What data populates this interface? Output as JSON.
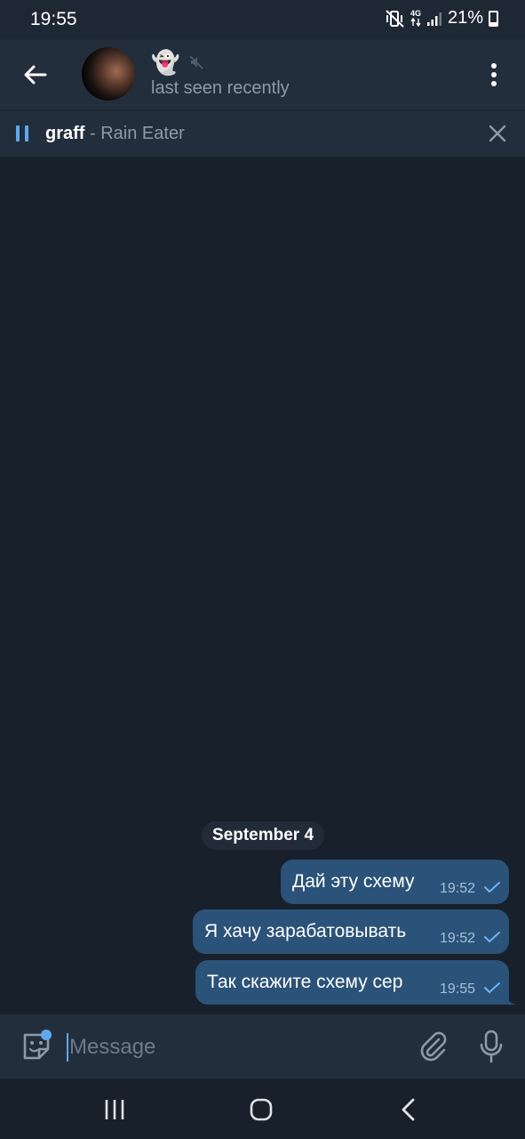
{
  "status_bar": {
    "time": "19:55",
    "network": "4G",
    "battery": "21%"
  },
  "header": {
    "chat_name": "👻",
    "chat_status": "last seen recently",
    "icons": [
      "back-arrow-icon",
      "avatar",
      "muted-icon",
      "more-vertical-icon"
    ]
  },
  "player": {
    "artist": "graff",
    "separator": " - ",
    "title": "Rain Eater",
    "icons": [
      "pause-icon",
      "close-icon"
    ]
  },
  "chat": {
    "date_label": "September 4",
    "messages": [
      {
        "text": "Дай эту схему",
        "time": "19:52",
        "status": "sent"
      },
      {
        "text": "Я хачу зарабатовывать",
        "time": "19:52",
        "status": "sent"
      },
      {
        "text": "Так скажите схему сер",
        "time": "19:55",
        "status": "sent"
      }
    ]
  },
  "composer": {
    "placeholder": "Message",
    "value": ""
  },
  "colors": {
    "background": "#18202b",
    "header": "#232e3c",
    "bubble_out": "#2b5278",
    "accent": "#5fa8ee"
  }
}
